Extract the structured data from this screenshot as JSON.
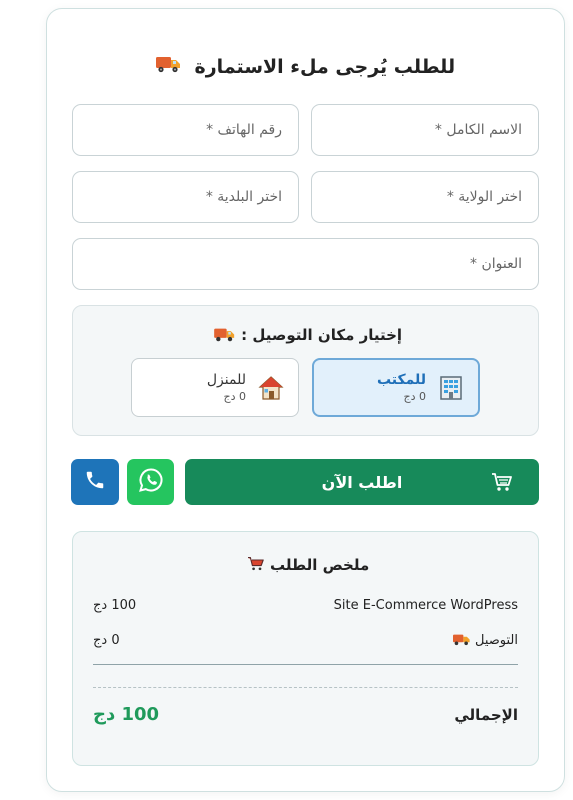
{
  "form": {
    "title": "للطلب يُرجى ملء الاستمارة",
    "fields": {
      "full_name": "الاسم الكامل *",
      "phone": "رقم الهاتف *",
      "wilaya": "اختر الولاية *",
      "commune": "اختر البلدية *",
      "address": "العنوان *"
    }
  },
  "delivery": {
    "title": "إختيار مكان التوصيل :",
    "options": [
      {
        "label": "للمكتب",
        "price": "0 دج",
        "icon": "office-building-icon",
        "selected": true
      },
      {
        "label": "للمنزل",
        "price": "0 دج",
        "icon": "house-icon",
        "selected": false
      }
    ]
  },
  "actions": {
    "order_label": "اطلب الآن",
    "whatsapp_icon": "whatsapp-icon",
    "phone_icon": "phone-icon"
  },
  "summary": {
    "title": "ملخص الطلب",
    "product_name": "Site E-Commerce WordPress",
    "product_price": "100 دج",
    "shipping_label": "التوصيل",
    "shipping_price": "0 دج",
    "total_label": "الإجمالي",
    "total_value": "100 دج"
  },
  "colors": {
    "primary_green": "#178a5a",
    "whatsapp_green": "#25c55f",
    "phone_blue": "#1e74b9",
    "selected_blue": "#1f6fb8",
    "total_green": "#1f9a5b"
  }
}
